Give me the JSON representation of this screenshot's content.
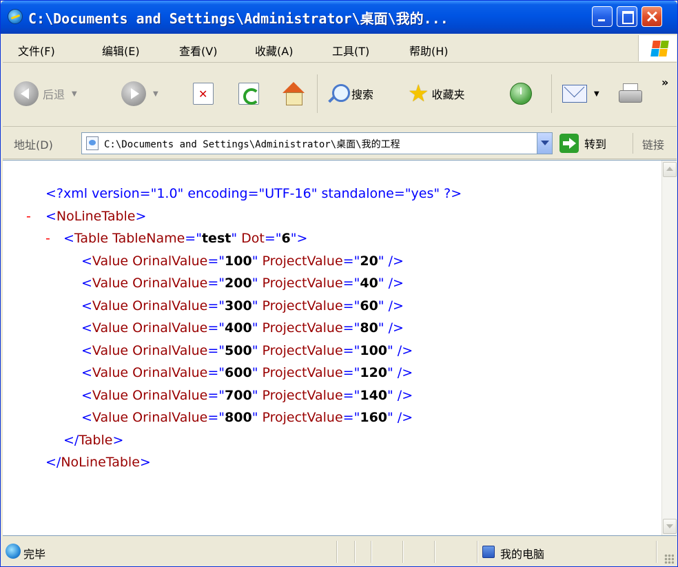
{
  "window": {
    "title": "C:\\Documents and Settings\\Administrator\\桌面\\我的..."
  },
  "menu": {
    "items": [
      "文件(F)",
      "编辑(E)",
      "查看(V)",
      "收藏(A)",
      "工具(T)",
      "帮助(H)"
    ]
  },
  "toolbar": {
    "back_label": "后退",
    "search_label": "搜索",
    "favorites_label": "收藏夹",
    "more": "»"
  },
  "address": {
    "label": "地址(D)",
    "value": "C:\\Documents and Settings\\Administrator\\桌面\\我的工程",
    "go_label": "转到",
    "links_label": "链接"
  },
  "xml": {
    "declaration": "<?xml version=\"1.0\" encoding=\"UTF-16\" standalone=\"yes\" ?>",
    "collapse_marker": "-",
    "root_tag": "NoLineTable",
    "table_tag": "Table",
    "table_name_attr": "TableName",
    "table_name": "test",
    "dot_attr": "Dot",
    "dot": "6",
    "value_tag": "Value",
    "orinal_attr": "OrinalValue",
    "project_attr": "ProjectValue",
    "values": [
      {
        "orinal": "100",
        "project": "20"
      },
      {
        "orinal": "200",
        "project": "40"
      },
      {
        "orinal": "300",
        "project": "60"
      },
      {
        "orinal": "400",
        "project": "80"
      },
      {
        "orinal": "500",
        "project": "100"
      },
      {
        "orinal": "600",
        "project": "120"
      },
      {
        "orinal": "700",
        "project": "140"
      },
      {
        "orinal": "800",
        "project": "160"
      }
    ]
  },
  "status": {
    "text": "完毕",
    "zone": "我的电脑"
  }
}
